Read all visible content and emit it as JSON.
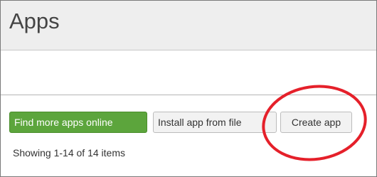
{
  "page": {
    "title": "Apps"
  },
  "actions": {
    "find_more": "Find more apps online",
    "install_from_file": "Install app from file",
    "create": "Create app"
  },
  "list": {
    "showing": "Showing 1-14 of 14 items"
  },
  "colors": {
    "header_bg": "#eeeeee",
    "primary_button": "#5ca53c",
    "annotation": "#e5202a"
  }
}
